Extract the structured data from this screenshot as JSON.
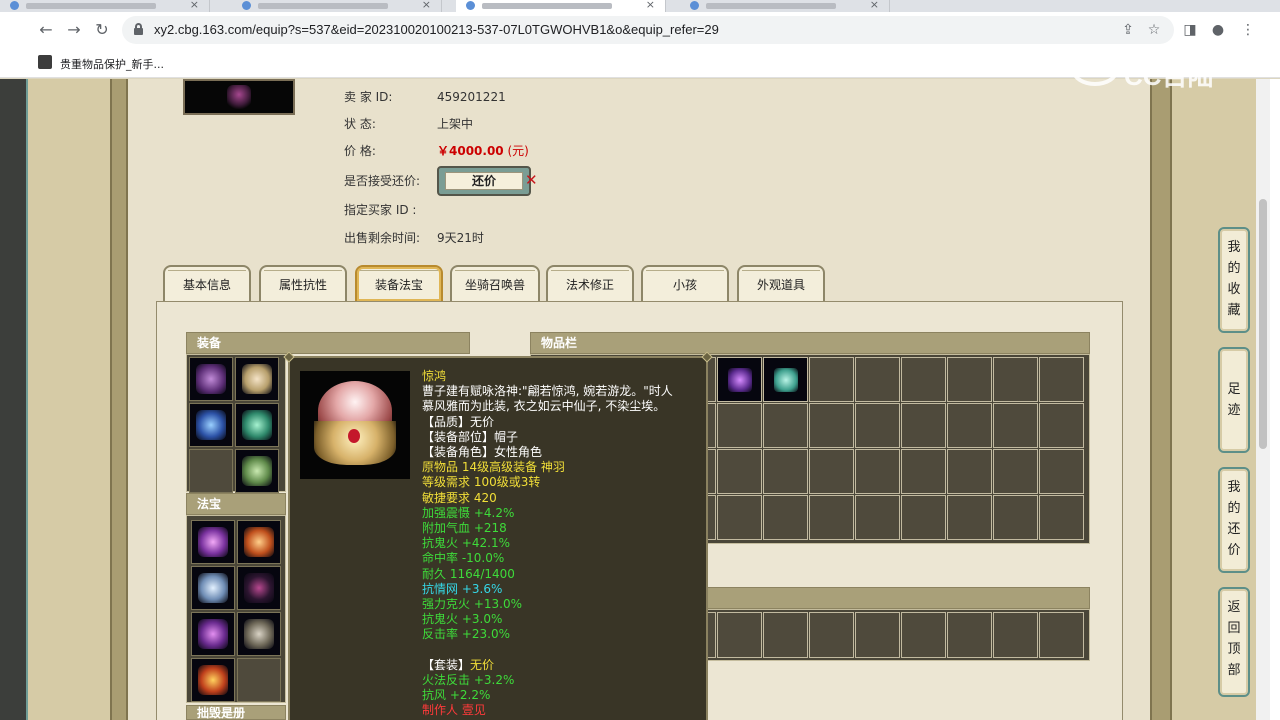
{
  "browser": {
    "url": "xy2.cbg.163.com/equip?s=537&eid=202310020100213-537-07L0TGWOHVB1&o&equip_refer=29",
    "bookmark_label": "贵重物品保护_新手...",
    "watermark": "CC百陆"
  },
  "seller": {
    "id_label": "卖 家 ID:",
    "id_value": "459201221",
    "status_label": "状     态:",
    "status_value": "上架中",
    "price_label": "价     格:",
    "price_value": "￥4000.00",
    "price_unit": "(元)",
    "haggle_label": "是否接受还价:",
    "haggle_button": "还价",
    "buyer_id_label": "指定买家 ID :",
    "remaining_label": "出售剩余时间:",
    "remaining_value": "9天21时"
  },
  "tabs": [
    "基本信息",
    "属性抗性",
    "装备法宝",
    "坐骑召唤兽",
    "法术修正",
    "小孩",
    "外观道具"
  ],
  "active_tab": "装备法宝",
  "sections": {
    "equipment": "装备",
    "inventory": "物品栏",
    "treasure": "法宝",
    "bottom_cut": "拙毁是册"
  },
  "tooltip": {
    "name": "惊鸿",
    "desc_line1": "曹子建有赋咏洛神:\"翩若惊鸿, 婉若游龙。\"时人",
    "desc_line2": "慕风雅而为此装, 衣之如云中仙子, 不染尘埃。",
    "quality": "【品质】无价",
    "slot": "【装备部位】帽子",
    "role": "【装备角色】女性角色",
    "origin": "原物品 14级高级装备 神羽",
    "level_req": "等级需求 100级或3转",
    "agility_req": "敏捷要求 420",
    "stats_green": [
      "加强震慑 +4.2%",
      "附加气血 +218",
      "抗鬼火 +42.1%",
      "命中率 -10.0%",
      "耐久 1164/1400"
    ],
    "stat_cyan": "抗情网 +3.6%",
    "stats_green2": [
      "强力克火 +13.0%",
      "抗鬼火 +3.0%",
      "反击率 +23.0%"
    ],
    "set_label": "【套装】",
    "set_value": "无价",
    "set_stats": [
      "火法反击 +3.2%",
      "抗风 +2.2%"
    ],
    "maker": "制作人 壹见"
  },
  "float_nav": [
    "我的收藏",
    "足迹",
    "我的还价",
    "返回顶部"
  ],
  "colors": {
    "price_red": "#cc0000",
    "tooltip_bg": "#393526",
    "tooltip_yellow": "#f2df38",
    "tooltip_green": "#3edb3a",
    "tooltip_cyan": "#35d7e6",
    "header_tan": "#a9a079",
    "accent_teal": "#5d8f88"
  },
  "icons": {
    "back": "arrow-left-icon",
    "forward": "arrow-right-icon",
    "reload": "reload-icon",
    "lock": "lock-icon",
    "share": "share-icon",
    "star": "star-icon",
    "sidebar": "sidebar-icon",
    "profile": "profile-icon",
    "menu": "kebab-menu-icon"
  }
}
